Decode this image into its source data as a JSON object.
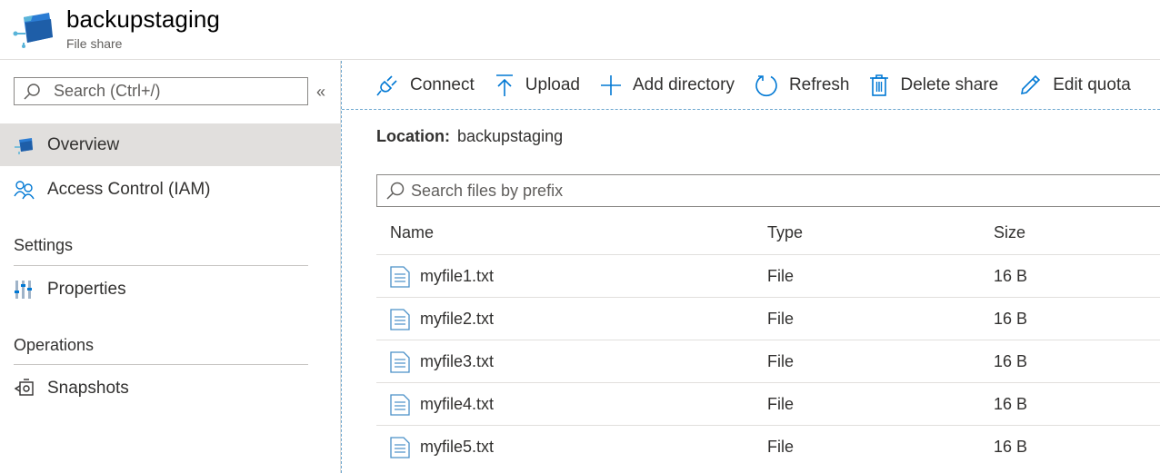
{
  "header": {
    "title": "backupstaging",
    "subtitle": "File share",
    "logo_icon": "file-share-icon"
  },
  "sidebar": {
    "search_placeholder": "Search (Ctrl+/)",
    "collapse_glyph": "«",
    "items": [
      {
        "label": "Overview",
        "icon": "file-share-icon",
        "active": true
      },
      {
        "label": "Access Control (IAM)",
        "icon": "people-icon",
        "active": false
      }
    ],
    "sections": [
      {
        "title": "Settings",
        "items": [
          {
            "label": "Properties",
            "icon": "sliders-icon"
          }
        ]
      },
      {
        "title": "Operations",
        "items": [
          {
            "label": "Snapshots",
            "icon": "snapshots-icon"
          }
        ]
      }
    ]
  },
  "toolbar": {
    "connect": "Connect",
    "upload": "Upload",
    "add_directory": "Add directory",
    "refresh": "Refresh",
    "delete_share": "Delete share",
    "edit_quota": "Edit quota"
  },
  "location": {
    "label": "Location:",
    "value": "backupstaging"
  },
  "file_search": {
    "placeholder": "Search files by prefix"
  },
  "table": {
    "columns": [
      "Name",
      "Type",
      "Size"
    ],
    "rows": [
      {
        "name": "myfile1.txt",
        "type": "File",
        "size": "16 B"
      },
      {
        "name": "myfile2.txt",
        "type": "File",
        "size": "16 B"
      },
      {
        "name": "myfile3.txt",
        "type": "File",
        "size": "16 B"
      },
      {
        "name": "myfile4.txt",
        "type": "File",
        "size": "16 B"
      },
      {
        "name": "myfile5.txt",
        "type": "File",
        "size": "16 B"
      }
    ]
  },
  "colors": {
    "accent": "#0078d4",
    "active_nav_bg": "#e1dfdd",
    "text": "#323130",
    "dashed_border": "#6ea8d0"
  }
}
